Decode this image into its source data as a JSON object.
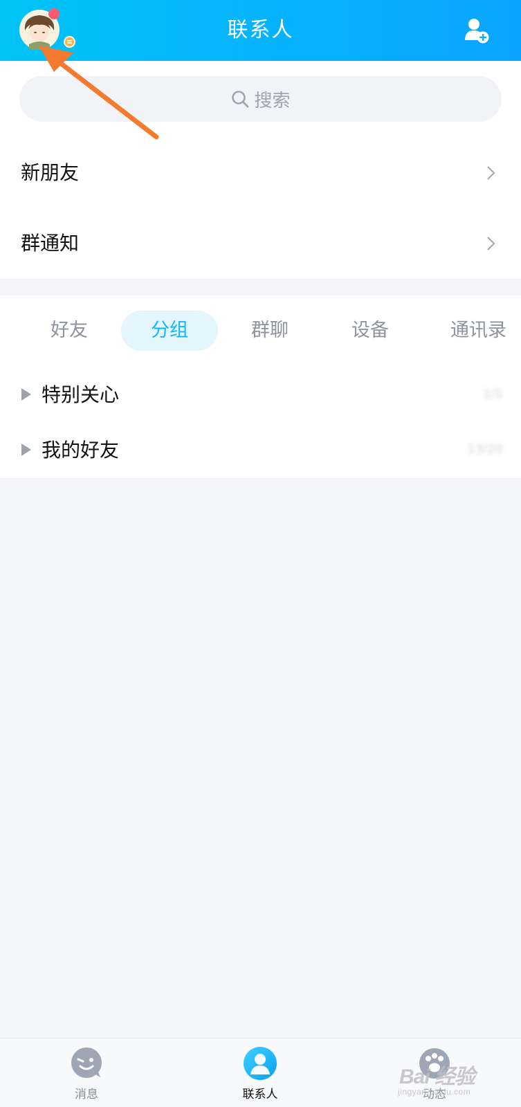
{
  "header": {
    "title": "联系人",
    "avatar_icon": "user-avatar-cartoon",
    "add_icon": "add-contact-icon"
  },
  "search": {
    "placeholder": "搜索",
    "icon": "search-icon"
  },
  "entries": [
    {
      "label": "新朋友"
    },
    {
      "label": "群通知"
    }
  ],
  "tabs": [
    {
      "label": "好友",
      "active": false
    },
    {
      "label": "分组",
      "active": true
    },
    {
      "label": "群聊",
      "active": false
    },
    {
      "label": "设备",
      "active": false
    },
    {
      "label": "通讯录",
      "active": false
    }
  ],
  "groups": [
    {
      "label": "特别关心",
      "count": "1/1"
    },
    {
      "label": "我的好友",
      "count": "13/20"
    }
  ],
  "bottom_nav": [
    {
      "label": "消息",
      "icon": "message-wink-icon",
      "active": false
    },
    {
      "label": "联系人",
      "icon": "contacts-person-icon",
      "active": true
    },
    {
      "label": "动态",
      "icon": "paw-icon",
      "active": false
    }
  ],
  "watermark": {
    "main": "Bai 经验",
    "sub": "jingyan.baidu.com"
  },
  "colors": {
    "accent": "#12b7f5",
    "header_start": "#00c3f5",
    "header_end": "#0aa4ff",
    "annotation_arrow": "#f47a30"
  }
}
